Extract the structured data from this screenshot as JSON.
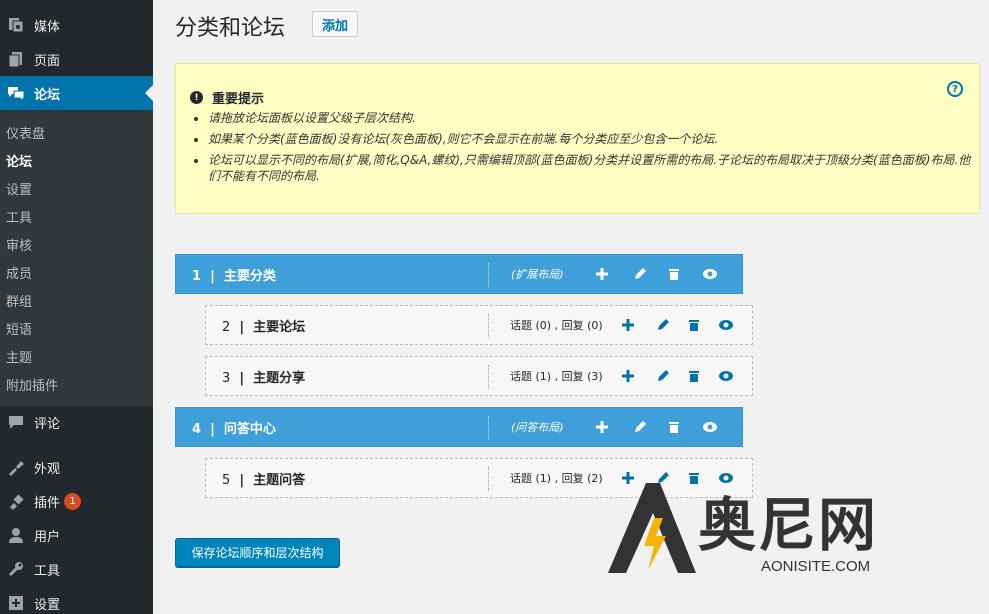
{
  "sidebar": {
    "top_items": [
      {
        "label": "媒体",
        "icon": "media-icon"
      },
      {
        "label": "页面",
        "icon": "pages-icon"
      },
      {
        "label": "论坛",
        "icon": "forum-icon",
        "active": true
      }
    ],
    "submenu": [
      {
        "label": "仪表盘"
      },
      {
        "label": "论坛",
        "current": true
      },
      {
        "label": "设置"
      },
      {
        "label": "工具"
      },
      {
        "label": "审核"
      },
      {
        "label": "成员"
      },
      {
        "label": "群组"
      },
      {
        "label": "短语"
      },
      {
        "label": "主题"
      },
      {
        "label": "附加插件"
      }
    ],
    "bottom_items": [
      {
        "label": "评论",
        "icon": "comments-icon"
      },
      {
        "label": "外观",
        "icon": "appearance-icon"
      },
      {
        "label": "插件",
        "icon": "plugins-icon",
        "badge": "1"
      },
      {
        "label": "用户",
        "icon": "users-icon"
      },
      {
        "label": "工具",
        "icon": "tools-icon"
      },
      {
        "label": "设置",
        "icon": "settings-icon"
      }
    ]
  },
  "header": {
    "title": "分类和论坛",
    "add_label": "添加"
  },
  "notice": {
    "title": "重要提示",
    "items": [
      "请拖放论坛面板以设置父级子层次结构.",
      "如果某个分类(蓝色面板)没有论坛(灰色面板),则它不会显示在前端.每个分类应至少包含一个论坛.",
      "论坛可以显示不同的布局(扩展,简化,Q&A,螺纹),只需编辑顶部(蓝色面板)分类并设置所需的布局.子论坛的布局取决于顶级分类(蓝色面板)布局.他们不能有不同的布局."
    ]
  },
  "rows": [
    {
      "type": "category",
      "num": "1",
      "name": "主要分类",
      "meta": "(扩展布局)"
    },
    {
      "type": "forum",
      "num": "2",
      "name": "主要论坛",
      "meta": "话题 (0) , 回复 (0)"
    },
    {
      "type": "forum",
      "num": "3",
      "name": "主题分享",
      "meta": "话题 (1) , 回复 (3)"
    },
    {
      "type": "category",
      "num": "4",
      "name": "问答中心",
      "meta": "(问答布局)"
    },
    {
      "type": "forum",
      "num": "5",
      "name": "主题问答",
      "meta": "话题 (1) , 回复 (2)"
    }
  ],
  "save_label": "保存论坛顺序和层次结构",
  "watermark": {
    "text": "奥尼网",
    "sub": "AONISITE.COM"
  },
  "colors": {
    "accent": "#0073aa",
    "category_blue": "#3f9fd8",
    "notice_bg": "#ffffc3"
  }
}
